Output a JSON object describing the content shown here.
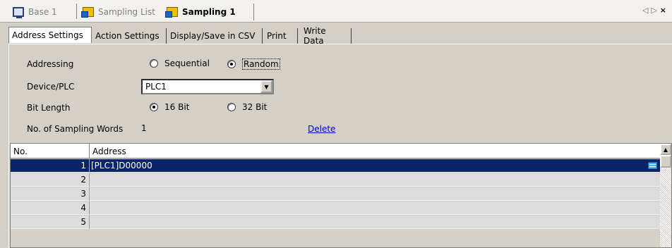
{
  "doc_tabs": [
    {
      "label": "Base 1",
      "icon": "base-screen-icon"
    },
    {
      "label": "Sampling List",
      "icon": "sampling-icon"
    },
    {
      "label": "Sampling 1",
      "icon": "sampling-icon",
      "active": true
    }
  ],
  "nav": {
    "left": "◁",
    "right": "▷",
    "close": "×"
  },
  "prop_tabs": [
    {
      "label": "Address Settings",
      "active": true
    },
    {
      "label": "Action Settings"
    },
    {
      "label": "Display/Save in CSV"
    },
    {
      "label": "Print"
    },
    {
      "label": "Write Data"
    }
  ],
  "form": {
    "addressing": {
      "label": "Addressing",
      "options": [
        "Sequential",
        "Random"
      ],
      "selected": "Random"
    },
    "device_plc": {
      "label": "Device/PLC",
      "value": "PLC1"
    },
    "bit_length": {
      "label": "Bit Length",
      "options": [
        "16 Bit",
        "32 Bit"
      ],
      "selected": "16 Bit"
    },
    "sampling_words": {
      "label": "No. of Sampling Words",
      "value": "1"
    },
    "delete_link": "Delete"
  },
  "grid": {
    "columns": [
      "No.",
      "Address"
    ],
    "rows": [
      {
        "no": "1",
        "address": "[PLC1]D00000",
        "selected": true
      },
      {
        "no": "2",
        "address": ""
      },
      {
        "no": "3",
        "address": ""
      },
      {
        "no": "4",
        "address": ""
      },
      {
        "no": "5",
        "address": ""
      }
    ]
  },
  "colors": {
    "selection": "#0a246a",
    "link": "#0000cc",
    "panel": "#d4d0c8"
  }
}
